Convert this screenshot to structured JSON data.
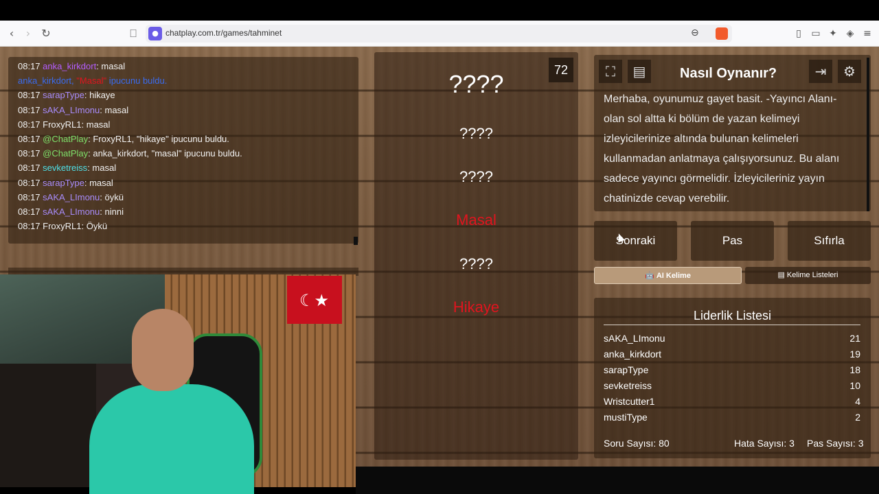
{
  "browser": {
    "url": "chatplay.com.tr/games/tahminet"
  },
  "chat": {
    "lines": [
      {
        "time": "08:17",
        "user": "anka_kirkdort",
        "user_color": "#b35dff",
        "msg": ": masal"
      },
      {
        "time": "",
        "user": "anka_kirkdort, ",
        "user_color": "#3a6cf0",
        "msg": "\"Masal\" ipucunu buldu.",
        "highlight": "\"Masal\""
      },
      {
        "time": "08:17",
        "user": "sarapType",
        "user_color": "#a78bfa",
        "msg": ": hikaye"
      },
      {
        "time": "08:17",
        "user": "sAKA_LImonu",
        "user_color": "#a78bfa",
        "msg": ": masal"
      },
      {
        "time": "08:17",
        "user": "FroxyRL1",
        "user_color": "#f2f2f2",
        "msg": ": masal"
      },
      {
        "time": "08:17",
        "user": "@ChatPlay",
        "user_color": "#7ee06a",
        "msg": ": FroxyRL1, \"hikaye\" ipucunu buldu."
      },
      {
        "time": "08:17",
        "user": "@ChatPlay",
        "user_color": "#7ee06a",
        "msg": ": anka_kirkdort, \"masal\" ipucunu buldu."
      },
      {
        "time": "08:17",
        "user": "sevketreiss",
        "user_color": "#4ee0e8",
        "msg": ": masal"
      },
      {
        "time": "08:17",
        "user": "sarapType",
        "user_color": "#a78bfa",
        "msg": ": masal"
      },
      {
        "time": "08:17",
        "user": "sAKA_LImonu",
        "user_color": "#a78bfa",
        "msg": ": öykü"
      },
      {
        "time": "08:17",
        "user": "sAKA_LImonu",
        "user_color": "#a78bfa",
        "msg": ": ninni"
      },
      {
        "time": "08:17",
        "user": "FroxyRL1",
        "user_color": "#f2f2f2",
        "msg": ": Öykü"
      }
    ]
  },
  "game": {
    "timer": "72",
    "main_word": "????",
    "clues": [
      "????",
      "????",
      "Masal",
      "????",
      "Hikaye"
    ]
  },
  "howto": {
    "title": "Nasıl Oynanır?",
    "text": "Merhaba, oyunumuz gayet basit. -Yayıncı Alanı- olan sol altta ki bölüm de yazan kelimeyi izleyicilerinize altında bulunan kelimeleri kullanmadan anlatmaya çalışıyorsunuz. Bu alanı sadece yayıncı görmelidir. İzleyicileriniz yayın chatinizde cevap verebilir."
  },
  "buttons": {
    "next": "Sonraki",
    "pass": "Pas",
    "reset": "Sıfırla",
    "ai_word": "AI Kelime",
    "word_lists": "Kelime Listeleri"
  },
  "leaderboard": {
    "title": "Liderlik Listesi",
    "rows": [
      {
        "name": "sAKA_LImonu",
        "score": "21"
      },
      {
        "name": "anka_kirkdort",
        "score": "19"
      },
      {
        "name": "sarapType",
        "score": "18"
      },
      {
        "name": "sevketreiss",
        "score": "10"
      },
      {
        "name": "Wristcutter1",
        "score": "4"
      },
      {
        "name": "mustiType",
        "score": "2"
      }
    ],
    "question_count": "Soru Sayısı: 80",
    "error_count": "Hata Sayısı: 3",
    "pass_count": "Pas Sayısı: 3"
  },
  "colors": {
    "found_clue": "#e0141e"
  }
}
